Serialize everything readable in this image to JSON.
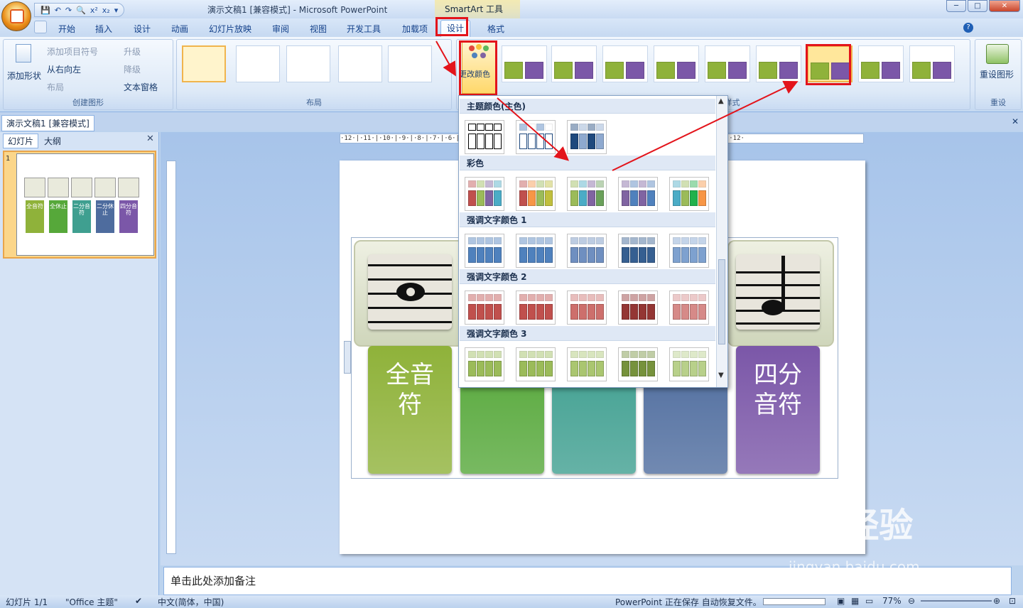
{
  "titlebar": {
    "qat_items": [
      "💾",
      "↶",
      "↷",
      "🔍",
      "x²",
      "x₂",
      "▾"
    ],
    "window_title": "演示文稿1 [兼容模式] - Microsoft PowerPoint",
    "context_title": "SmartArt 工具"
  },
  "tabs": [
    "开始",
    "插入",
    "设计",
    "动画",
    "幻灯片放映",
    "审阅",
    "视图",
    "开发工具",
    "加载项",
    "设计",
    "格式"
  ],
  "ribbon": {
    "create": {
      "add_shape": "添加形状",
      "add_bullet": "添加项目符号",
      "rtl": "从右向左",
      "layout": "布局",
      "promote": "升级",
      "demote": "降级",
      "text_pane": "文本窗格",
      "label": "创建图形"
    },
    "layout_label": "布局",
    "change_colors": "更改颜色",
    "styles_label": "SmartArt 样式",
    "reset": "重设图形",
    "reset_label": "重设"
  },
  "doc_tab": "演示文稿1 [兼容模式]",
  "left_panel": {
    "tab_slides": "幻灯片",
    "tab_outline": "大纲",
    "slide_number": "1",
    "thumb_labels": [
      "全音符",
      "全休止",
      "二分音符",
      "二分休止",
      "四分音符"
    ]
  },
  "ruler_h": "·12·|·11·|·10·|·9·|·8·|·7·|·6·|·5·|·4·|·3·|·2·|·1·|·0·|·1·|·2·|·3·|·4·|·5·|·6·|·7·|·8·|·9·|·10·|·11·|·12·",
  "slide": {
    "cards": [
      {
        "text": "全音\n符",
        "color": "#8fb23a"
      },
      {
        "text": "止",
        "color": "#56a83a"
      },
      {
        "text": "音符",
        "color": "#3f9f90"
      },
      {
        "text": "休止",
        "color": "#4e6c9e"
      },
      {
        "text": "四分\n音符",
        "color": "#7b57a8"
      }
    ]
  },
  "dropdown": {
    "sections": [
      {
        "title": "主题颜色(主色)",
        "colors": [
          [
            "#000000"
          ],
          [
            "#4f81bd",
            "#ffffff"
          ],
          [
            "#1f497d",
            "#8ea9cf"
          ]
        ]
      },
      {
        "title": "彩色",
        "colors": [
          [
            "#c0504d",
            "#9bbb59",
            "#8064a2",
            "#4bacc6"
          ],
          [
            "#c0504d",
            "#f79646",
            "#9bbb59",
            "#c0bf3d"
          ],
          [
            "#9bbb59",
            "#4bacc6",
            "#8064a2",
            "#6aa05a"
          ],
          [
            "#8064a2",
            "#4f81bd",
            "#8064a2",
            "#4f81bd"
          ],
          [
            "#4bacc6",
            "#9bbb59",
            "#22b14c",
            "#f79646"
          ]
        ]
      },
      {
        "title": "强调文字颜色 1",
        "colors": [
          [
            "#4f81bd"
          ],
          [
            "#4f81bd"
          ],
          [
            "#6f8fc0"
          ],
          [
            "#365f91"
          ],
          [
            "#7ea1cf"
          ]
        ]
      },
      {
        "title": "强调文字颜色 2",
        "colors": [
          [
            "#c0504d"
          ],
          [
            "#c0504d"
          ],
          [
            "#cd6f6c"
          ],
          [
            "#943634"
          ],
          [
            "#d68a88"
          ]
        ]
      },
      {
        "title": "强调文字颜色 3",
        "colors": [
          [
            "#9bbb59"
          ],
          [
            "#9bbb59"
          ],
          [
            "#aac670"
          ],
          [
            "#76923c"
          ],
          [
            "#b8d08a"
          ]
        ]
      }
    ]
  },
  "notes_placeholder": "单击此处添加备注",
  "status": {
    "slide": "幻灯片 1/1",
    "theme": "\"Office 主题\"",
    "lang": "中文(简体，中国)",
    "saving": "PowerPoint 正在保存 自动恢复文件。",
    "zoom": "77%"
  },
  "watermark": {
    "brand": "Bai经验",
    "url": "jingyan.baidu.com"
  },
  "colors": {
    "highlight": "#e3141b",
    "arrow": "#e3141b"
  }
}
